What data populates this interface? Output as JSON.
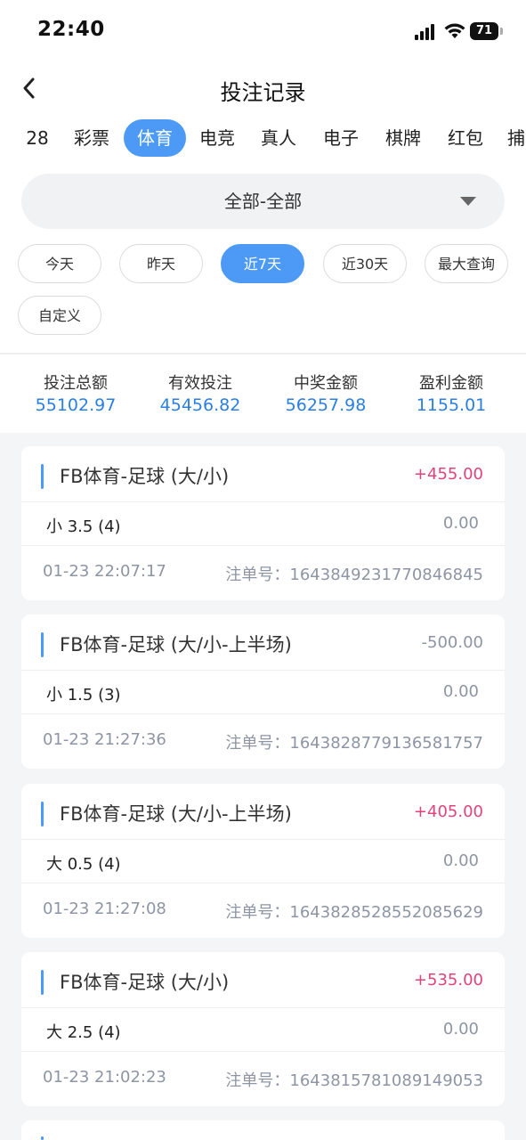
{
  "status_bar": {
    "time": "22:40",
    "battery": "71"
  },
  "header": {
    "title": "投注记录"
  },
  "category_tabs": [
    "28",
    "彩票",
    "体育",
    "电竞",
    "真人",
    "电子",
    "棋牌",
    "红包",
    "捕"
  ],
  "active_category": "体育",
  "filter_dropdown": {
    "value": "全部-全部"
  },
  "date_filters": [
    "今天",
    "昨天",
    "近7天",
    "近30天",
    "最大查询",
    "自定义"
  ],
  "active_date_filter": "近7天",
  "summary": [
    {
      "label": "投注总额",
      "value": "55102.97"
    },
    {
      "label": "有效投注",
      "value": "45456.82"
    },
    {
      "label": "中奖金额",
      "value": "56257.98"
    },
    {
      "label": "盈利金额",
      "value": "1155.01"
    }
  ],
  "order_label": "注单号：",
  "bets": [
    {
      "title": "FB体育-足球 (大/小)",
      "amount": "+455.00",
      "pick": "小 3.5 (4)",
      "payout": "0.00",
      "time": "01-23 22:07:17",
      "order_no": "1643849231770846845"
    },
    {
      "title": "FB体育-足球 (大/小-上半场)",
      "amount": "-500.00",
      "pick": "小 1.5 (3)",
      "payout": "0.00",
      "time": "01-23 21:27:36",
      "order_no": "1643828779136581757"
    },
    {
      "title": "FB体育-足球 (大/小-上半场)",
      "amount": "+405.00",
      "pick": "大 0.5 (4)",
      "payout": "0.00",
      "time": "01-23 21:27:08",
      "order_no": "1643828528552085629"
    },
    {
      "title": "FB体育-足球 (大/小)",
      "amount": "+535.00",
      "pick": "大 2.5 (4)",
      "payout": "0.00",
      "time": "01-23 21:02:23",
      "order_no": "1643815781089149053"
    }
  ]
}
